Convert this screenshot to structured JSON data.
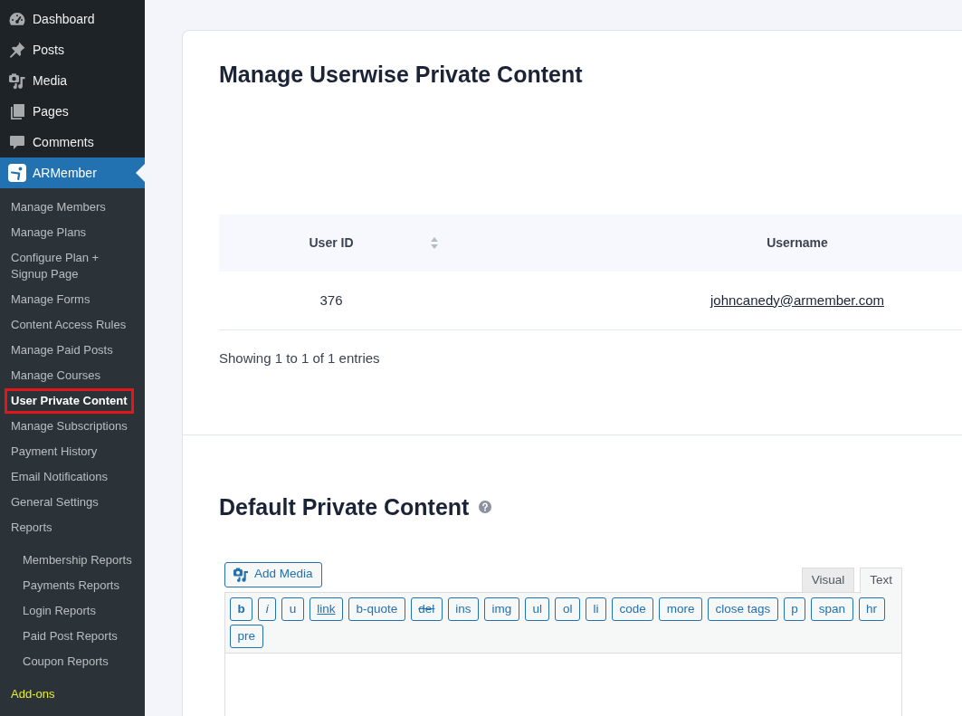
{
  "sidebar": {
    "menu": [
      {
        "label": "Dashboard",
        "kind": "dashboard",
        "selected": false
      },
      {
        "label": "Posts",
        "kind": "posts",
        "selected": false
      },
      {
        "label": "Media",
        "kind": "media",
        "selected": false
      },
      {
        "label": "Pages",
        "kind": "pages",
        "selected": false
      },
      {
        "label": "Comments",
        "kind": "comments",
        "selected": false
      },
      {
        "label": "ARMember",
        "kind": "armember",
        "selected": true
      }
    ],
    "submenu": [
      {
        "label": "Manage Members",
        "selected": false,
        "outlined": false
      },
      {
        "label": "Manage Plans",
        "selected": false,
        "outlined": false
      },
      {
        "label": "Configure Plan + Signup Page",
        "selected": false,
        "outlined": false
      },
      {
        "label": "Manage Forms",
        "selected": false,
        "outlined": false
      },
      {
        "label": "Content Access Rules",
        "selected": false,
        "outlined": false
      },
      {
        "label": "Manage Paid Posts",
        "selected": false,
        "outlined": false
      },
      {
        "label": "Manage Courses",
        "selected": false,
        "outlined": false
      },
      {
        "label": "User Private Content",
        "selected": true,
        "outlined": true
      },
      {
        "label": "Manage Subscriptions",
        "selected": false,
        "outlined": false
      },
      {
        "label": "Payment History",
        "selected": false,
        "outlined": false
      },
      {
        "label": "Email Notifications",
        "selected": false,
        "outlined": false
      },
      {
        "label": "General Settings",
        "selected": false,
        "outlined": false
      },
      {
        "label": "Reports",
        "selected": false,
        "outlined": false,
        "children": [
          {
            "label": "Membership Reports",
            "selected": false,
            "outlined": false
          },
          {
            "label": "Payments Reports",
            "selected": false,
            "outlined": false
          },
          {
            "label": "Login Reports",
            "selected": false,
            "outlined": false
          },
          {
            "label": "Paid Post Reports",
            "selected": false,
            "outlined": false
          },
          {
            "label": "Coupon Reports",
            "selected": false,
            "outlined": false
          }
        ]
      },
      {
        "label": "Add-ons",
        "selected": false,
        "outlined": false,
        "color": "#e8f02a"
      }
    ]
  },
  "userwise_section": {
    "title": "Manage Userwise Private Content",
    "table": {
      "columns": [
        {
          "label": "User ID",
          "sortable": true
        },
        {
          "label": "Username",
          "sortable": false
        }
      ],
      "rows": [
        {
          "cells": [
            {
              "text": "376",
              "kind": "plain"
            },
            {
              "text": "johncanedy@armember.com",
              "kind": "link"
            }
          ]
        }
      ]
    },
    "info": "Showing 1 to 1 of 1 entries"
  },
  "default_section": {
    "title": "Default Private Content",
    "editor": {
      "add_media": "Add Media",
      "tabs": [
        {
          "label": "Visual",
          "selected": false
        },
        {
          "label": "Text",
          "selected": true
        }
      ],
      "quicktags": [
        {
          "label": "b",
          "kind": "bold"
        },
        {
          "label": "i",
          "kind": "italic"
        },
        {
          "label": "u",
          "kind": "plain"
        },
        {
          "label": "link",
          "kind": "underline"
        },
        {
          "label": "b-quote",
          "kind": "plain"
        },
        {
          "label": "del",
          "kind": "strike"
        },
        {
          "label": "ins",
          "kind": "plain"
        },
        {
          "label": "img",
          "kind": "plain"
        },
        {
          "label": "ul",
          "kind": "plain"
        },
        {
          "label": "ol",
          "kind": "plain"
        },
        {
          "label": "li",
          "kind": "plain"
        },
        {
          "label": "code",
          "kind": "plain"
        },
        {
          "label": "more",
          "kind": "plain"
        },
        {
          "label": "close tags",
          "kind": "plain"
        },
        {
          "label": "p",
          "kind": "plain"
        },
        {
          "label": "span",
          "kind": "plain"
        },
        {
          "label": "hr",
          "kind": "plain"
        },
        {
          "label": "pre",
          "kind": "plain"
        }
      ]
    }
  }
}
